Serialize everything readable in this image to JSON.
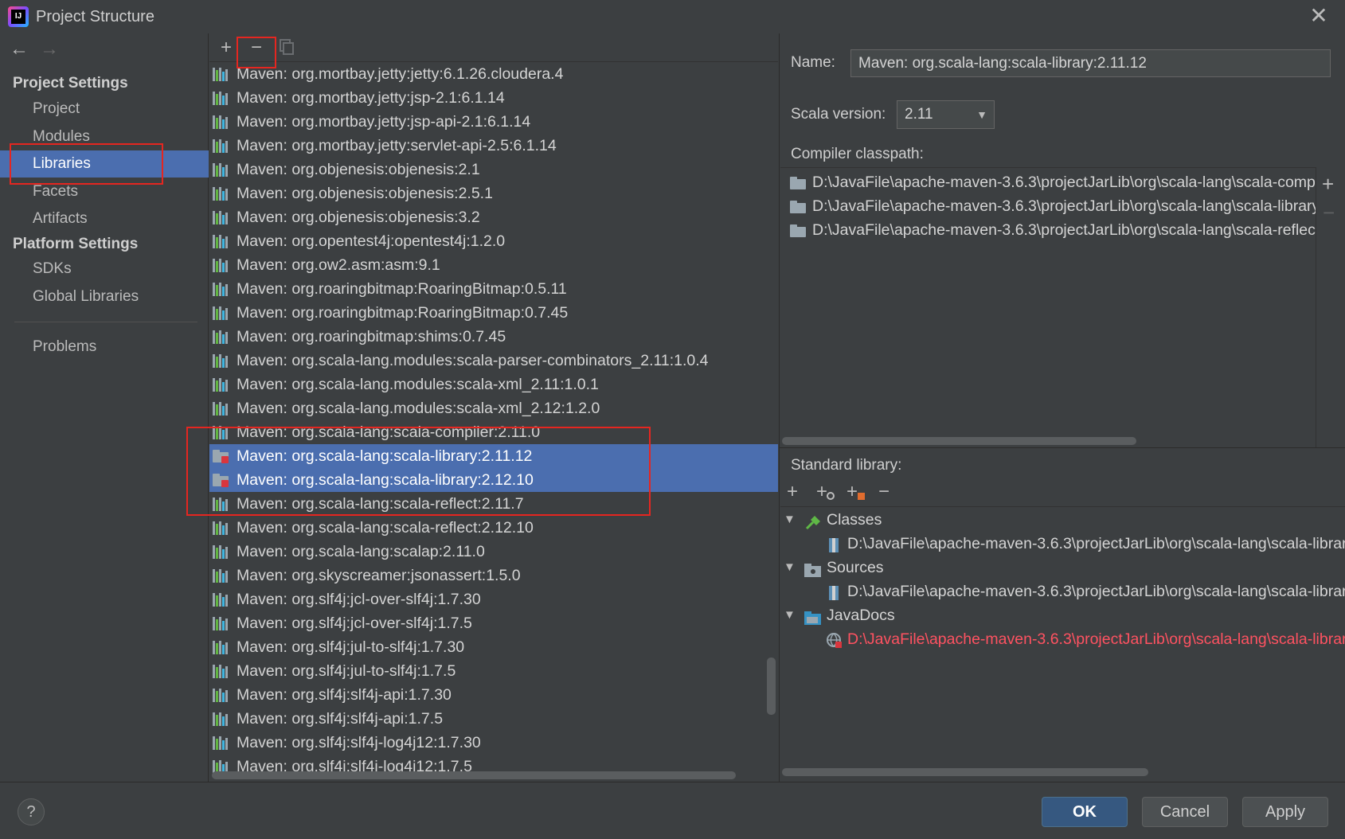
{
  "window": {
    "title": "Project Structure",
    "logo_text": "IJ"
  },
  "sidebar": {
    "back_glyph": "←",
    "forward_glyph": "→",
    "sections": [
      {
        "title": "Project Settings",
        "items": [
          "Project",
          "Modules",
          "Libraries",
          "Facets",
          "Artifacts"
        ]
      },
      {
        "title": "Platform Settings",
        "items": [
          "SDKs",
          "Global Libraries"
        ]
      }
    ],
    "extra_items": [
      "Problems"
    ],
    "selected": "Libraries"
  },
  "libraries_toolbar": {
    "add": "+",
    "remove": "−"
  },
  "libraries": [
    "Maven: org.mortbay.jetty:jetty:6.1.26.cloudera.4",
    "Maven: org.mortbay.jetty:jsp-2.1:6.1.14",
    "Maven: org.mortbay.jetty:jsp-api-2.1:6.1.14",
    "Maven: org.mortbay.jetty:servlet-api-2.5:6.1.14",
    "Maven: org.objenesis:objenesis:2.1",
    "Maven: org.objenesis:objenesis:2.5.1",
    "Maven: org.objenesis:objenesis:3.2",
    "Maven: org.opentest4j:opentest4j:1.2.0",
    "Maven: org.ow2.asm:asm:9.1",
    "Maven: org.roaringbitmap:RoaringBitmap:0.5.11",
    "Maven: org.roaringbitmap:RoaringBitmap:0.7.45",
    "Maven: org.roaringbitmap:shims:0.7.45",
    "Maven: org.scala-lang.modules:scala-parser-combinators_2.11:1.0.4",
    "Maven: org.scala-lang.modules:scala-xml_2.11:1.0.1",
    "Maven: org.scala-lang.modules:scala-xml_2.12:1.2.0",
    "Maven: org.scala-lang:scala-compiler:2.11.0",
    "Maven: org.scala-lang:scala-library:2.11.12",
    "Maven: org.scala-lang:scala-library:2.12.10",
    "Maven: org.scala-lang:scala-reflect:2.11.7",
    "Maven: org.scala-lang:scala-reflect:2.12.10",
    "Maven: org.scala-lang:scalap:2.11.0",
    "Maven: org.skyscreamer:jsonassert:1.5.0",
    "Maven: org.slf4j:jcl-over-slf4j:1.7.30",
    "Maven: org.slf4j:jcl-over-slf4j:1.7.5",
    "Maven: org.slf4j:jul-to-slf4j:1.7.30",
    "Maven: org.slf4j:jul-to-slf4j:1.7.5",
    "Maven: org.slf4j:slf4j-api:1.7.30",
    "Maven: org.slf4j:slf4j-api:1.7.5",
    "Maven: org.slf4j:slf4j-log4j12:1.7.30",
    "Maven: org.slf4j:slf4j-log4j12:1.7.5"
  ],
  "selected_libraries": [
    "Maven: org.scala-lang:scala-library:2.11.12",
    "Maven: org.scala-lang:scala-library:2.12.10"
  ],
  "library_icons": {
    "default": "library-bars-icon",
    "selected": "folder-error-icon"
  },
  "details": {
    "name_label": "Name:",
    "name_value": "Maven: org.scala-lang:scala-library:2.11.12",
    "scala_version_label": "Scala version:",
    "scala_version_value": "2.11",
    "compiler_classpath_label": "Compiler classpath:",
    "compiler_classpath": [
      "D:\\JavaFile\\apache-maven-3.6.3\\projectJarLib\\org\\scala-lang\\scala-compi",
      "D:\\JavaFile\\apache-maven-3.6.3\\projectJarLib\\org\\scala-lang\\scala-library",
      "D:\\JavaFile\\apache-maven-3.6.3\\projectJarLib\\org\\scala-lang\\scala-reflect"
    ],
    "classpath_add": "+",
    "classpath_remove": "−",
    "standard_library_label": "Standard library:",
    "std_toolbar": [
      "+",
      "+",
      "+",
      "−"
    ],
    "tree": [
      {
        "node": "Classes",
        "icon": "hammer-icon",
        "child": "D:\\JavaFile\\apache-maven-3.6.3\\projectJarLib\\org\\scala-lang\\scala-librar",
        "child_icon": "jar-icon",
        "error": false
      },
      {
        "node": "Sources",
        "icon": "source-folder-icon",
        "child": "D:\\JavaFile\\apache-maven-3.6.3\\projectJarLib\\org\\scala-lang\\scala-librar",
        "child_icon": "jar-icon",
        "error": false
      },
      {
        "node": "JavaDocs",
        "icon": "javadoc-folder-icon",
        "child": "D:\\JavaFile\\apache-maven-3.6.3\\projectJarLib\\org\\scala-lang\\scala-librar",
        "child_icon": "globe-error-icon",
        "error": true
      }
    ]
  },
  "footer": {
    "help": "?",
    "ok": "OK",
    "cancel": "Cancel",
    "apply": "Apply"
  },
  "colors": {
    "accent": "#4b6eaf",
    "primary_button": "#365880",
    "error_text": "#ff5261",
    "annotation": "#e52620",
    "background": "#3c3f41"
  }
}
